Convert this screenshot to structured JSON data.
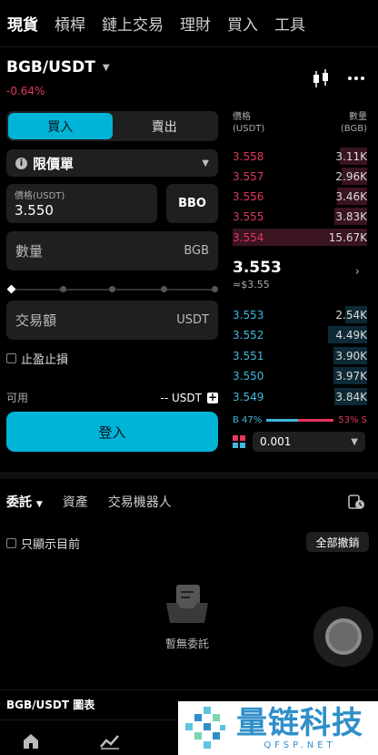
{
  "top_tabs": [
    {
      "label": "現貨",
      "active": true
    },
    {
      "label": "槓桿",
      "active": false
    },
    {
      "label": "鏈上交易",
      "active": false
    },
    {
      "label": "理財",
      "active": false
    },
    {
      "label": "買入",
      "active": false
    },
    {
      "label": "工具",
      "active": false
    }
  ],
  "pair": {
    "name": "BGB/USDT",
    "change": "-0.64%"
  },
  "trade": {
    "side_buy": "買入",
    "side_sell": "賣出",
    "order_type": "限價單",
    "price_label": "價格(USDT)",
    "price_value": "3.550",
    "bbo_label": "BBO",
    "qty_placeholder": "數量",
    "qty_unit": "BGB",
    "amount_placeholder": "交易額",
    "amount_unit": "USDT",
    "tpsl_label": "止盈止損",
    "available_label": "可用",
    "available_value": "-- USDT",
    "login_label": "登入"
  },
  "orderbook": {
    "price_header": "價格\n(USDT)",
    "qty_header": "數量\n(BGB)",
    "asks": [
      {
        "price": "3.558",
        "qty": "3.11K",
        "depth": 0.2
      },
      {
        "price": "3.557",
        "qty": "2.96K",
        "depth": 0.19
      },
      {
        "price": "3.556",
        "qty": "3.46K",
        "depth": 0.22
      },
      {
        "price": "3.555",
        "qty": "3.83K",
        "depth": 0.24
      },
      {
        "price": "3.554",
        "qty": "15.67K",
        "depth": 1.0
      }
    ],
    "mid_price": "3.553",
    "mid_usd": "≈$3.55",
    "bids": [
      {
        "price": "3.553",
        "qty": "2.54K",
        "depth": 0.16
      },
      {
        "price": "3.552",
        "qty": "4.49K",
        "depth": 0.29
      },
      {
        "price": "3.551",
        "qty": "3.90K",
        "depth": 0.25
      },
      {
        "price": "3.550",
        "qty": "3.97K",
        "depth": 0.25
      },
      {
        "price": "3.549",
        "qty": "3.84K",
        "depth": 0.24
      }
    ],
    "buy_ratio_label": "B 47%",
    "sell_ratio_label": "53% S",
    "buy_ratio": 0.47,
    "depth_value": "0.001"
  },
  "bottom": {
    "tabs": [
      {
        "label": "委託",
        "active": true
      },
      {
        "label": "資產",
        "active": false
      },
      {
        "label": "交易機器人",
        "active": false
      }
    ],
    "only_current": "只顯示目前",
    "cancel_all": "全部撤銷",
    "empty_text": "暫無委託",
    "chart_link": "BGB/USDT 圖表"
  },
  "watermark": {
    "cn": "量链科技",
    "url": "QFSP.NET"
  },
  "colors": {
    "accent": "#00b4d8",
    "ask": "#e5365e",
    "bid": "#3fb9dc"
  }
}
